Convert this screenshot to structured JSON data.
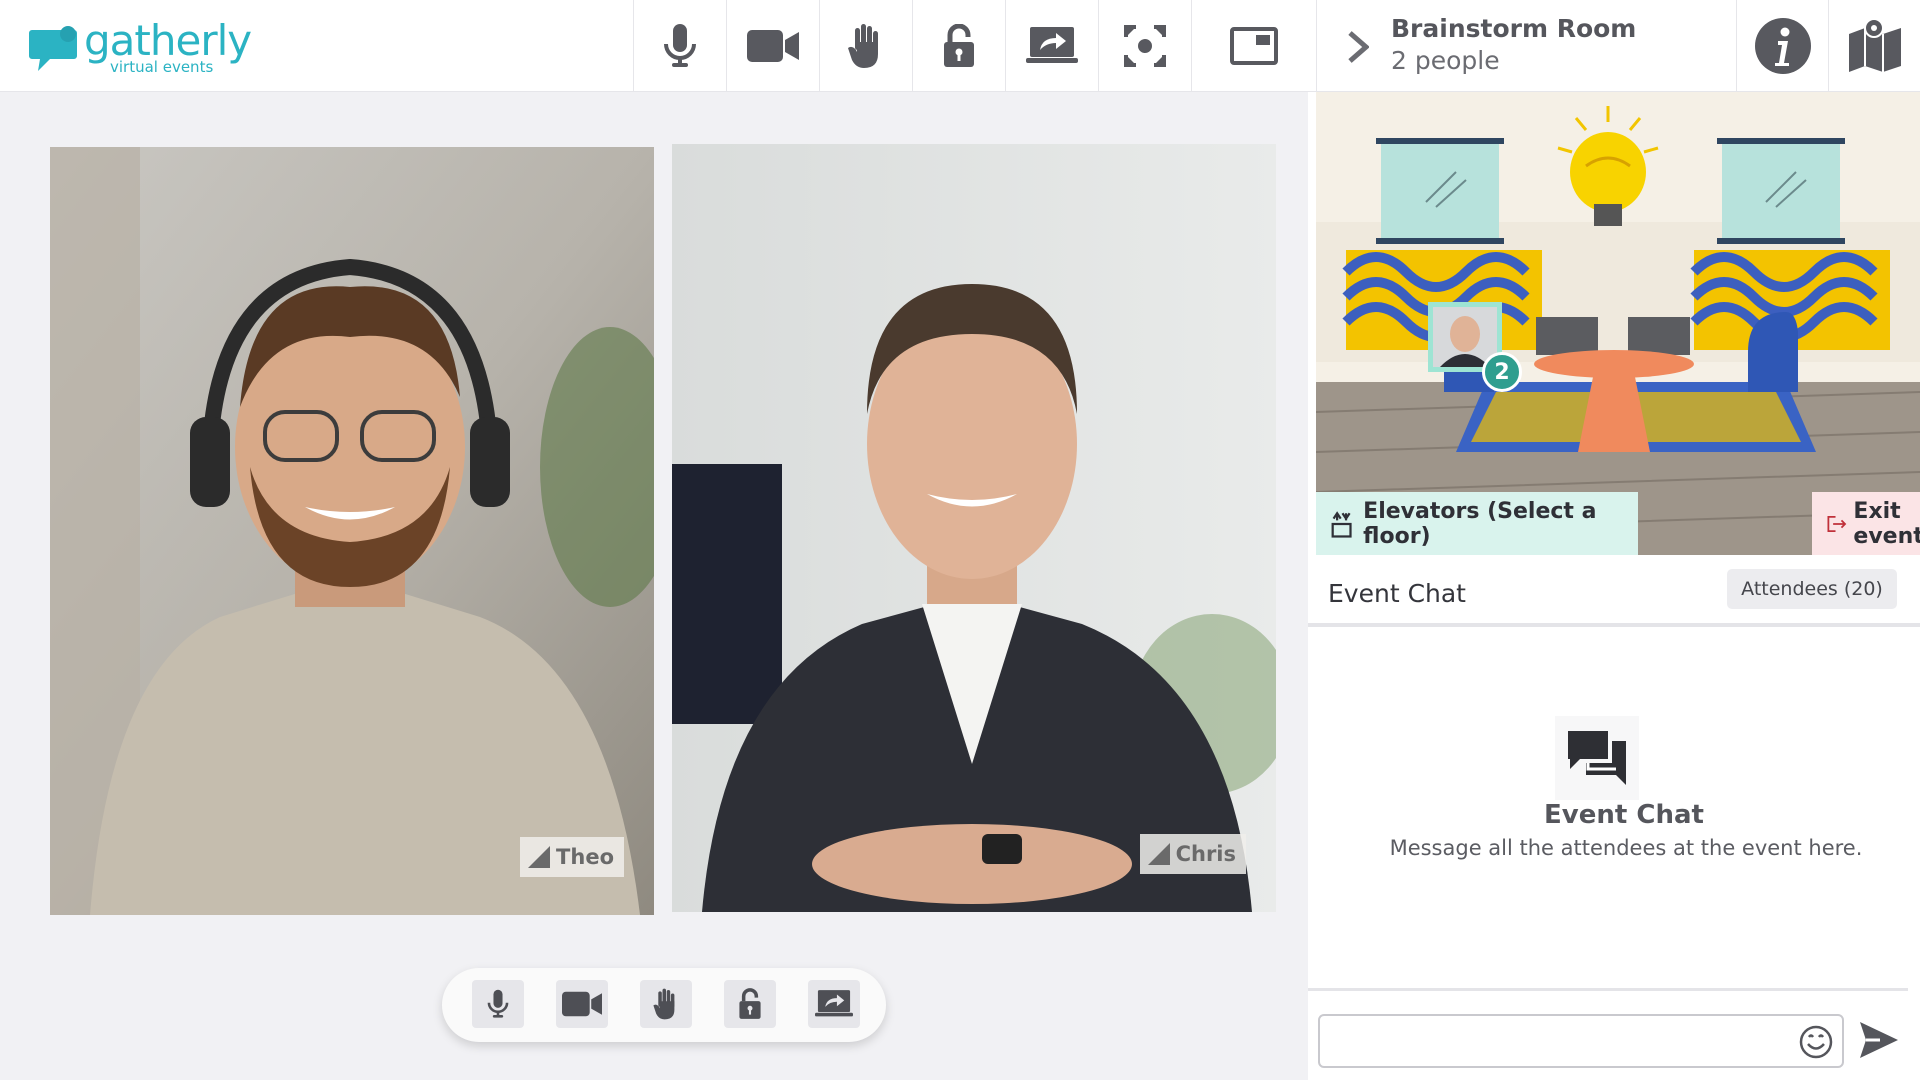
{
  "app": {
    "logo_word": "gatherly",
    "logo_sub": "virtual events",
    "brand_color": "#2bb3c3"
  },
  "toolbar": {
    "buttons": [
      {
        "name": "microphone",
        "icon": "microphone-icon"
      },
      {
        "name": "camera",
        "icon": "camera-icon"
      },
      {
        "name": "raise-hand",
        "icon": "hand-icon"
      },
      {
        "name": "lock",
        "icon": "lock-icon"
      },
      {
        "name": "share-screen",
        "icon": "share-screen-icon"
      },
      {
        "name": "focus",
        "icon": "focus-icon"
      },
      {
        "name": "picture-in-picture",
        "icon": "pip-icon"
      }
    ]
  },
  "room": {
    "name": "Brainstorm Room",
    "count": "2 people"
  },
  "participants": [
    {
      "name": "Theo"
    },
    {
      "name": "Chris"
    }
  ],
  "map": {
    "group_badge": "2"
  },
  "actions": {
    "elevators": "Elevators (Select a floor)",
    "exit": "Exit event"
  },
  "chat": {
    "title": "Event Chat",
    "attendees_tab": "Attendees (20)",
    "empty_title": "Event Chat",
    "empty_subtitle": "Message all the attendees at the event here.",
    "input_value": "",
    "input_placeholder": ""
  },
  "colors": {
    "elevator_bg": "#d9f3ed",
    "exit_bg": "#fbe4e6",
    "accent": "#2bb3c3"
  }
}
